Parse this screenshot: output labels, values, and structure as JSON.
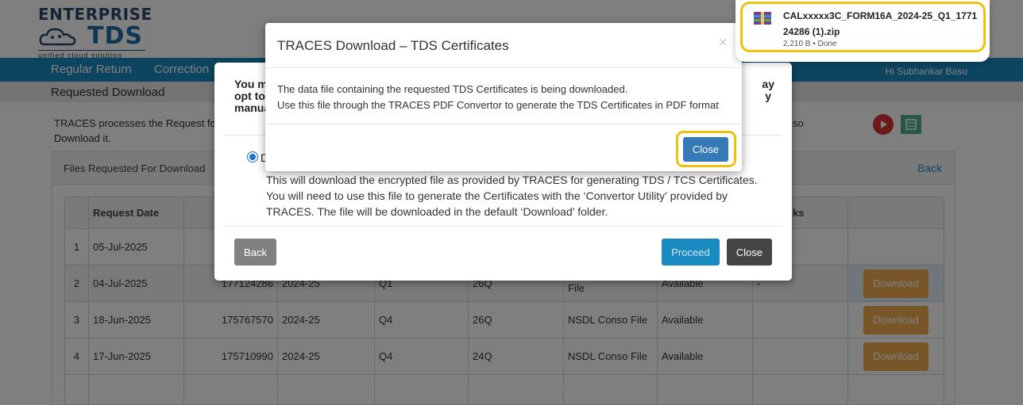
{
  "logo": {
    "top": "ENTERPRISE",
    "brand": "TDS",
    "tagline": "unified cloud solution"
  },
  "nav": {
    "items": [
      "Regular Return",
      "Correction"
    ],
    "user": "Hi Subhankar Basu"
  },
  "subbar": {
    "title": "Requested Download"
  },
  "info": {
    "text": "TRACES processes the Request for Download it.",
    "right_fragment": "so"
  },
  "panel": {
    "title": "Files Requested For Download",
    "back": "Back"
  },
  "table": {
    "headers": [
      "Request Date",
      "",
      "",
      "",
      "",
      "",
      "",
      "ks",
      ""
    ],
    "rows": [
      {
        "num": "1",
        "date": "05-Jul-2025",
        "req_no": "",
        "fy": "",
        "qtr": "",
        "form": "",
        "file_type": "",
        "status": "",
        "remarks": "",
        "action": ""
      },
      {
        "num": "2",
        "date": "04-Jul-2025",
        "req_no": "177124286",
        "fy": "2024-25",
        "qtr": "Q1",
        "form": "26Q",
        "file_type": "File",
        "status": "Available",
        "remarks": "-",
        "action": "Download"
      },
      {
        "num": "3",
        "date": "18-Jun-2025",
        "req_no": "175767570",
        "fy": "2024-25",
        "qtr": "Q4",
        "form": "26Q",
        "file_type": "NSDL Conso File",
        "status": "Available",
        "remarks": "",
        "action": "Download"
      },
      {
        "num": "4",
        "date": "17-Jun-2025",
        "req_no": "175710990",
        "fy": "2024-25",
        "qtr": "Q4",
        "form": "24Q",
        "file_type": "NSDL Conso File",
        "status": "Available",
        "remarks": "",
        "action": "Download"
      }
    ]
  },
  "bg_modal": {
    "message": "You m... opt to ... manua...",
    "msg_line1": "You m",
    "msg_line2": "opt to",
    "msg_line3": "manua",
    "msg_right1": "ay",
    "msg_right2": "y",
    "radio_label": "D",
    "description": "This will download the encrypted file as provided by TRACES for generating TDS / TCS Certificates. You will need to use this file to generate the Certificates with the ‘Convertor Utility’ provided by TRACES. The file will be downloaded in the default ‘Download’ folder.",
    "back": "Back",
    "proceed": "Proceed",
    "close": "Close"
  },
  "fg_modal": {
    "title": "TRACES Download – TDS Certificates",
    "close_x": "×",
    "line1": "The data file containing the requested TDS Certificates is being downloaded.",
    "line2": "Use this file through the TRACES PDF Convertor to generate the TDS Certificates in PDF format",
    "close": "Close"
  },
  "download": {
    "filename": "CALxxxxx3C_FORM16A_2024-25_Q1_177124286 (1).zip",
    "meta": "2,210 B • Done"
  },
  "colors": {
    "nav": "#1a8bc0",
    "highlight": "#f0c20f",
    "download_btn": "#f0ad4e",
    "primary": "#337ab7"
  }
}
